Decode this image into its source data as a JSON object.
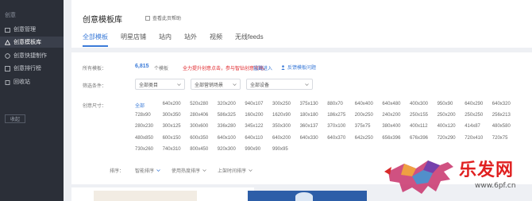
{
  "sidebar": {
    "title": "创意",
    "items": [
      {
        "label": "创意管理",
        "icon": "folder-icon"
      },
      {
        "label": "创意模板库",
        "icon": "triangle-icon",
        "active": true
      },
      {
        "label": "创意快捷制作",
        "icon": "lightning-icon"
      },
      {
        "label": "创意排行榜",
        "icon": "chart-icon"
      },
      {
        "label": "回收站",
        "icon": "trash-icon"
      }
    ],
    "collapse_label": "收起"
  },
  "header": {
    "title": "创意模板库",
    "help_label": "查看此页帮助",
    "tabs": [
      {
        "label": "全部模板",
        "active": true
      },
      {
        "label": "明星店铺"
      },
      {
        "label": "站内"
      },
      {
        "label": "站外"
      },
      {
        "label": "视频"
      },
      {
        "label": "无线feeds"
      }
    ]
  },
  "filters": {
    "all_templates_label": "所有模板：",
    "count": "6,815",
    "count_unit": "个模板",
    "promo_text": "全力提升创意点击，参与智钻创意攻略。",
    "promo_link": "猛戳进入",
    "feedback_link": "反馈模板问题",
    "filter_label": "筛选条件：",
    "selects": [
      "全部类目",
      "全部营销场景",
      "全部设备"
    ],
    "size_label": "创意尺寸：",
    "sizes": [
      [
        "全部",
        "640x200",
        "520x280",
        "320x200",
        "940x107",
        "300x250",
        "375x130",
        "880x70",
        "640x400",
        "640x480",
        "400x300",
        "950x90",
        "640x290",
        "640x320"
      ],
      [
        "728x90",
        "300x350",
        "280x406",
        "586x325",
        "160x200",
        "1620x90",
        "180x180",
        "186x275",
        "200x250",
        "240x200",
        "250x155",
        "250x200",
        "250x250",
        "256x213"
      ],
      [
        "280x230",
        "300x125",
        "300x600",
        "336x280",
        "345x122",
        "350x300",
        "360x137",
        "370x100",
        "375x75",
        "380x400",
        "400x112",
        "400x120",
        "414x87",
        "480x580"
      ],
      [
        "480x850",
        "600x150",
        "600x350",
        "640x100",
        "640x110",
        "640x200",
        "640x330",
        "640x370",
        "642x250",
        "656x396",
        "676x396",
        "720x290",
        "720x410",
        "720x75"
      ],
      [
        "730x260",
        "740x310",
        "800x450",
        "920x300",
        "990x90",
        "990x95"
      ]
    ],
    "sort_label": "排序：",
    "sort_options": [
      {
        "label": "智能排序",
        "active": true
      },
      {
        "label": "使用热度排序"
      },
      {
        "label": "上架时间排序"
      }
    ]
  },
  "watermark": {
    "text": "乐发网",
    "url": "www.6pf.cn"
  }
}
